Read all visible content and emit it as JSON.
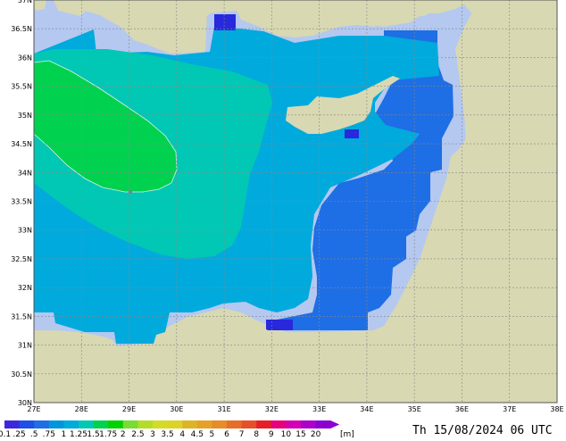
{
  "map": {
    "lat_labels": [
      "37N",
      "36.5N",
      "36N",
      "35.5N",
      "35N",
      "34.5N",
      "34N",
      "33.5N",
      "33N",
      "32.5N",
      "32N",
      "31.5N",
      "31N",
      "30.5N",
      "30N"
    ],
    "lon_labels": [
      "27E",
      "28E",
      "29E",
      "30E",
      "31E",
      "32E",
      "33E",
      "34E",
      "35E",
      "36E",
      "37E",
      "38E"
    ],
    "colors": {
      "land": "#d8d8b2",
      "sea_lightest": "#b4c8f0",
      "sea_blue": "#1e6ee6",
      "sea_darkblue": "#2828dc",
      "sea_teal": "#00aadc",
      "sea_aqua": "#00c8b4",
      "sea_green": "#00d250",
      "grid": "#888888"
    }
  },
  "legend": {
    "labels": [
      "0.1",
      ".25",
      ".5",
      ".75",
      "1",
      "1.25",
      "1.5",
      "1.75",
      "2",
      "2.5",
      "3",
      "3.5",
      "4",
      "4.5",
      "5",
      "6",
      "7",
      "8",
      "9",
      "10",
      "15",
      "20"
    ],
    "unit": "[m]",
    "colors": [
      "#3c28dc",
      "#1e50e6",
      "#1e6ee6",
      "#0096dc",
      "#00aadc",
      "#00c8b4",
      "#00d250",
      "#00d200",
      "#78dc32",
      "#b4dc28",
      "#d2dc28",
      "#dcd228",
      "#dcb428",
      "#e6a028",
      "#e68c28",
      "#e66e28",
      "#e65028",
      "#e61e28",
      "#e6007a",
      "#d200b4",
      "#aa00c8",
      "#8c00d2"
    ]
  },
  "timestamp": "Th 15/08/2024 06 UTC"
}
